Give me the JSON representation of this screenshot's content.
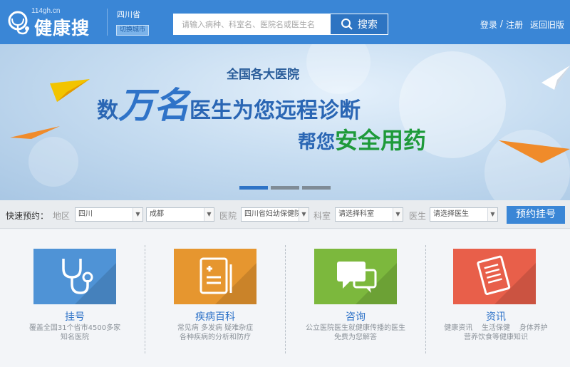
{
  "header": {
    "logo_url": "114gh.cn",
    "logo_name": "健康搜",
    "province": "四川省",
    "city_switch": "切换城市",
    "search_placeholder": "请输入病种、科室名、医院名或医生名",
    "search_button": "搜索",
    "login": "登录",
    "separator": "/",
    "register": "注册",
    "old_version": "返回旧版"
  },
  "banner": {
    "small_text": "全国各大医院",
    "line1_a": "数",
    "line1_b": "万名",
    "line1_c": "医生为您远程诊断",
    "line2_a": "帮您",
    "line2_b": "安全用药",
    "slides": 3,
    "active_slide": 0
  },
  "quick_booking": {
    "label": "快速预约：",
    "region_label": "地区",
    "region_province": "四川",
    "region_city": "成都",
    "hospital_label": "医院",
    "hospital_value": "四川省妇幼保健院",
    "dept_label": "科室",
    "dept_value": "请选择科室",
    "doctor_label": "医生",
    "doctor_value": "请选择医生",
    "book_button": "预约挂号"
  },
  "features": [
    {
      "title": "挂号",
      "desc1": "覆盖全国31个省市4500多家",
      "desc2": "知名医院",
      "color": "#4f93d6",
      "icon": "stethoscope-icon"
    },
    {
      "title": "疾病百科",
      "desc1": "常见病 多发病 疑难杂症",
      "desc2": "各种疾病的分析和防疗",
      "color": "#e6962f",
      "icon": "document-icon"
    },
    {
      "title": "咨询",
      "desc1": "公立医院医生就健康传播的医生",
      "desc2": "免费为您解答",
      "color": "#7cb83d",
      "icon": "chat-bubbles-icon"
    },
    {
      "title": "资讯",
      "desc1": "健康资讯    生活保健    身体养护",
      "desc2": "营养饮食等健康知识",
      "color": "#e85f4a",
      "icon": "newspaper-icon"
    }
  ]
}
